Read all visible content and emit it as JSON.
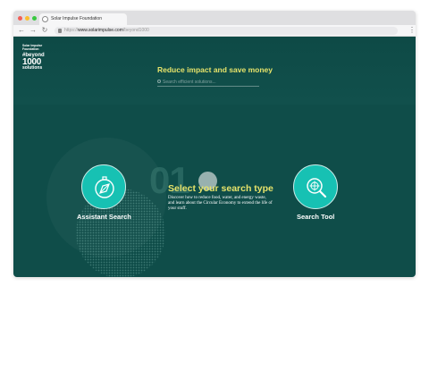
{
  "browser": {
    "tab_title": "Solar Impulse Foundation",
    "url_domain": "www.solarimpulse.com",
    "url_prefix": "https://",
    "url_path": "/beyond1000",
    "traffic_light_colors": [
      "#f25f58",
      "#fbbe2e",
      "#39c840"
    ]
  },
  "logo": {
    "line1": "Solar Impulse",
    "line2": "Foundation",
    "tagline": "#beyond",
    "number": "1000",
    "word": "solutions"
  },
  "header": {
    "headline": "Reduce impact and save money",
    "search_placeholder": "Search efficient solutions...",
    "search_icon": "search-icon"
  },
  "main": {
    "step_number": "01",
    "title": "Select your search type",
    "description": "Discover how to reduce food, water, and energy waste, and learn about the Circular Economy to extend the life of your stuff."
  },
  "options": {
    "assistant": {
      "label": "Assistant Search",
      "icon": "compass-icon"
    },
    "tool": {
      "label": "Search Tool",
      "icon": "magnifier-icon"
    }
  },
  "colors": {
    "page_background": "#0f4d49",
    "accent_yellow": "#e6e36a",
    "option_teal": "#17c1b3"
  }
}
